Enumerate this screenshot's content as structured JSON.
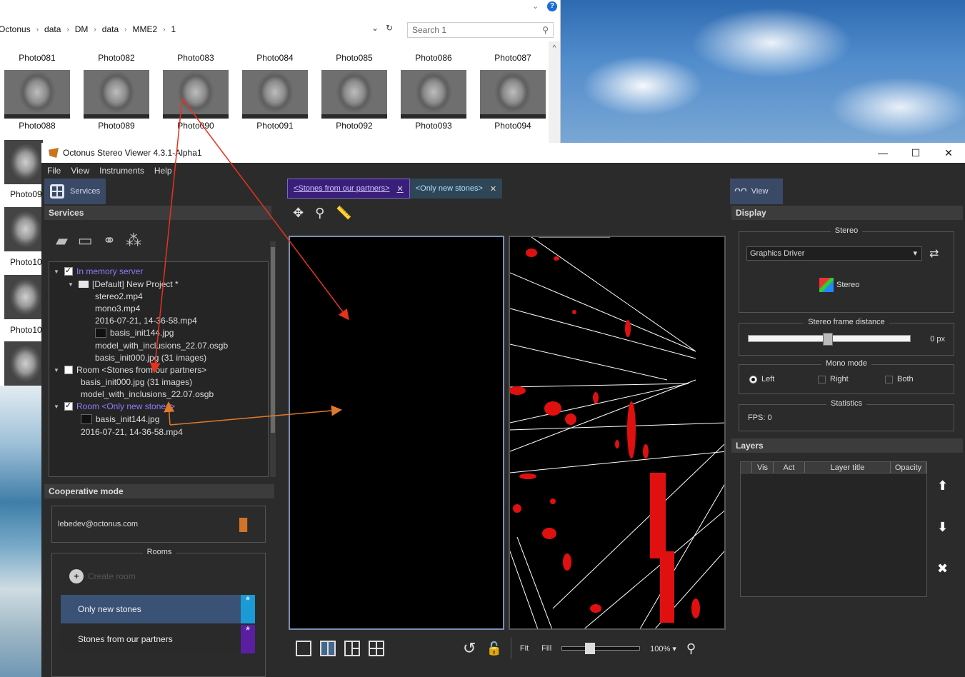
{
  "explorer": {
    "breadcrumbs": [
      "Octonus",
      "data",
      "DM",
      "data",
      "MME2",
      "1"
    ],
    "search_placeholder": "Search 1",
    "row1": [
      "Photo081",
      "Photo082",
      "Photo083",
      "Photo084",
      "Photo085",
      "Photo086",
      "Photo087"
    ],
    "row2": [
      "Photo088",
      "Photo089",
      "Photo090",
      "Photo091",
      "Photo092",
      "Photo093",
      "Photo094"
    ],
    "side_caps": [
      "Photo09",
      "Photo10",
      "Photo10"
    ]
  },
  "app": {
    "title": "Octonus Stereo Viewer 4.3.1-Alpha1",
    "menu": [
      "File",
      "View",
      "Instruments",
      "Help"
    ]
  },
  "left": {
    "tab_label": "Services",
    "services_header": "Services",
    "tree": [
      {
        "label": "In memory server"
      },
      {
        "label": "[Default] New Project *"
      },
      {
        "label": "stereo2.mp4"
      },
      {
        "label": "mono3.mp4"
      },
      {
        "label": "2016-07-21, 14-36-58.mp4"
      },
      {
        "label": "basis_init144.jpg"
      },
      {
        "label": "model_with_inclusions_22.07.osgb"
      },
      {
        "label": "basis_init000.jpg (31 images)"
      },
      {
        "label": "Room <Stones from our partners>"
      },
      {
        "label": "basis_init000.jpg (31 images)"
      },
      {
        "label": "model_with_inclusions_22.07.osgb"
      },
      {
        "label": "Room <Only new stones>"
      },
      {
        "label": "basis_init144.jpg"
      },
      {
        "label": "2016-07-21, 14-36-58.mp4"
      }
    ],
    "coop_header": "Cooperative mode",
    "user": "lebedev@octonus.com",
    "rooms_label": "Rooms",
    "create_room": "Create room",
    "rooms": [
      {
        "name": "Only new stones",
        "color": "#1a9bd6"
      },
      {
        "name": "Stones from our partners",
        "color": "#5a1fa0"
      }
    ]
  },
  "center": {
    "tabs": [
      "<Stones from our partners>",
      "<Only new stones>"
    ],
    "fit": "Fit",
    "fill": "Fill",
    "zoom": "100%",
    "zoom_fraction": 0.3
  },
  "right": {
    "tab_label": "View",
    "display_header": "Display",
    "stereo_label": "Stereo",
    "graphics_driver": "Graphics Driver",
    "stereo_button": "Stereo",
    "frame_distance_label": "Stereo frame distance",
    "frame_distance_value": "0 px",
    "mono_mode_label": "Mono mode",
    "mono_options": [
      "Left",
      "Right",
      "Both"
    ],
    "statistics_label": "Statistics",
    "fps": "FPS:  0",
    "layers_header": "Layers",
    "layer_columns": [
      "Vis",
      "Act",
      "Layer title",
      "Opacity"
    ]
  },
  "colors": {
    "accent_blue": "#44678e",
    "purple_tab": "#3a1f7a",
    "annotation_red": "#e8321e",
    "annotation_orange": "#e07a2a"
  }
}
